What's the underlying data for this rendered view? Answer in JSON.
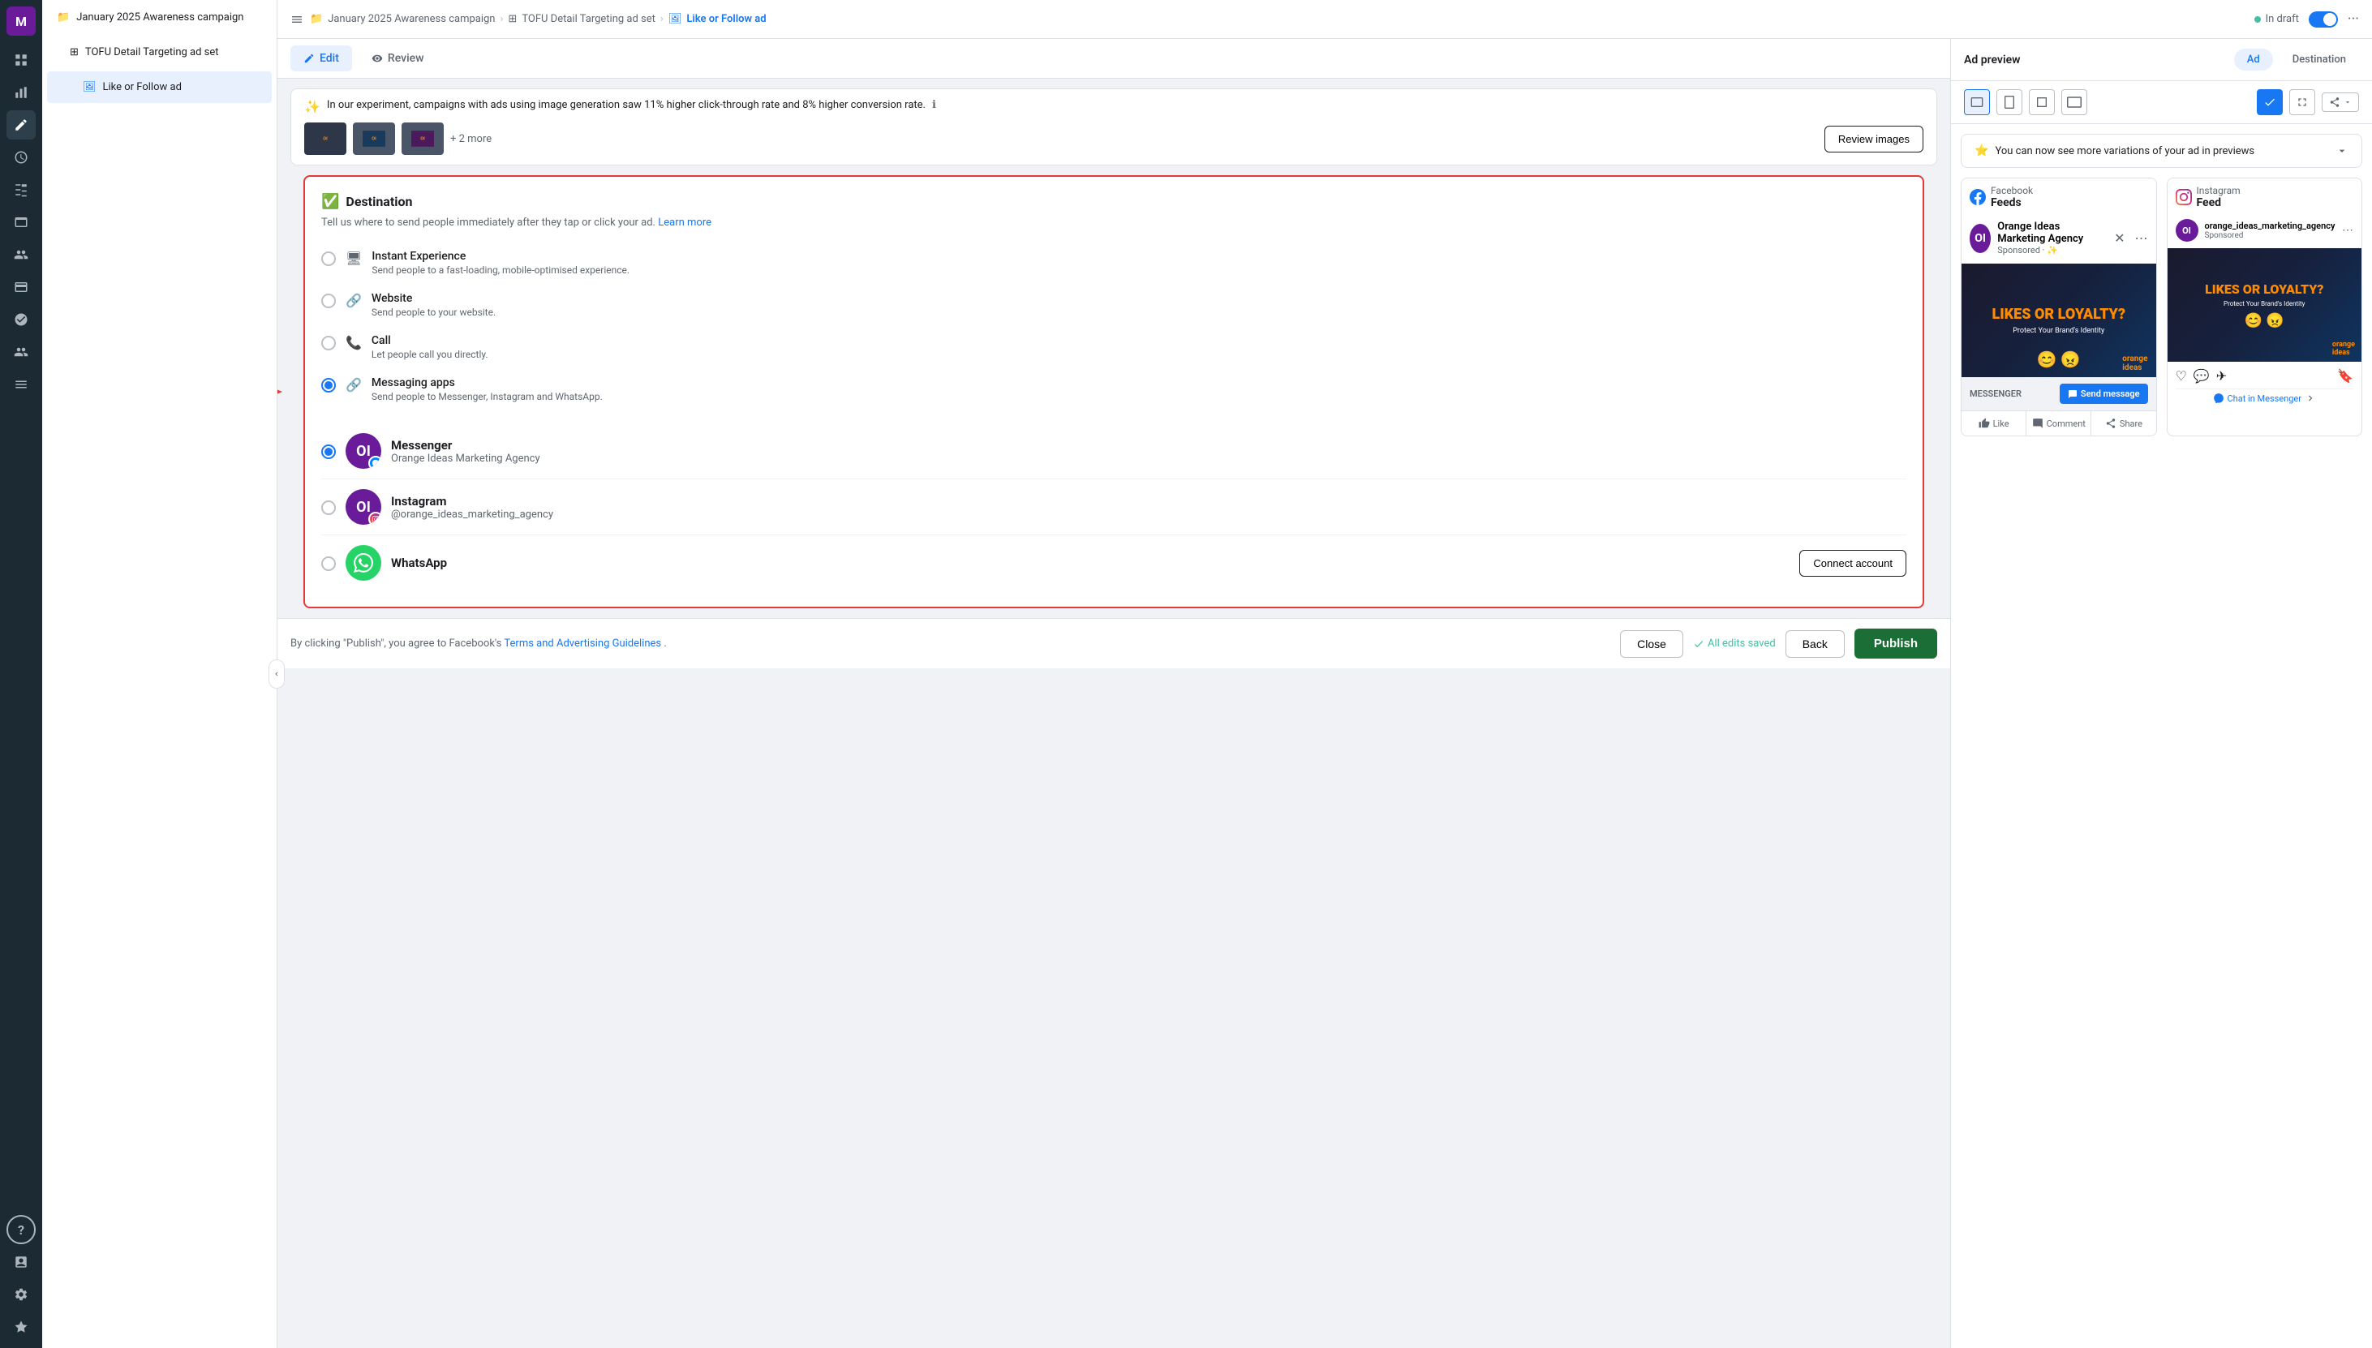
{
  "app": {
    "brand_initial": "M"
  },
  "sidebar_icons": [
    {
      "name": "brand-icon",
      "symbol": "M",
      "active": false
    },
    {
      "name": "bar-chart-icon",
      "symbol": "📊",
      "active": false
    },
    {
      "name": "pencil-icon",
      "symbol": "✏️",
      "active": true
    },
    {
      "name": "clock-icon",
      "symbol": "🕐",
      "active": false
    },
    {
      "name": "grid-icon",
      "symbol": "⊞",
      "active": false
    },
    {
      "name": "layers-icon",
      "symbol": "🗂",
      "active": false
    },
    {
      "name": "people-icon",
      "symbol": "👥",
      "active": false
    },
    {
      "name": "card-icon",
      "symbol": "💳",
      "active": false
    },
    {
      "name": "target-icon",
      "symbol": "🎯",
      "active": false
    },
    {
      "name": "org-icon",
      "symbol": "🔗",
      "active": false
    },
    {
      "name": "menu-icon",
      "symbol": "☰",
      "active": false
    }
  ],
  "nav": {
    "campaign_name": "January 2025 Awareness campaign",
    "adset_name": "TOFU Detail Targeting ad set",
    "ad_name": "Like or Follow ad"
  },
  "breadcrumb": {
    "campaign": "January 2025 Awareness campaign",
    "adset": "TOFU Detail Targeting ad set",
    "ad": "Like or Follow ad",
    "separator": ">"
  },
  "top_bar": {
    "sidebar_toggle": "📁",
    "status_label": "In draft",
    "more_icon": "···"
  },
  "edit_review": {
    "edit_label": "Edit",
    "review_label": "Review",
    "edit_icon": "✏️",
    "review_icon": "👁"
  },
  "ai_banner": {
    "text": "In our experiment, campaigns with ads using image generation saw 11% higher click-through rate and 8% higher conversion rate.",
    "info_icon": "ℹ"
  },
  "images": {
    "more_label": "+ 2 more",
    "review_button": "Review images"
  },
  "destination": {
    "title": "Destination",
    "description": "Tell us where to send people immediately after they tap or click your ad.",
    "learn_more": "Learn more",
    "options": [
      {
        "id": "instant-experience",
        "label": "Instant Experience",
        "description": "Send people to a fast-loading, mobile-optimised experience.",
        "icon": "🖥",
        "checked": false
      },
      {
        "id": "website",
        "label": "Website",
        "description": "Send people to your website.",
        "icon": "🔗",
        "checked": false
      },
      {
        "id": "call",
        "label": "Call",
        "description": "Let people call you directly.",
        "icon": "📞",
        "checked": false
      },
      {
        "id": "messaging-apps",
        "label": "Messaging apps",
        "description": "Send people to Messenger, Instagram and WhatsApp.",
        "icon": "🔗",
        "checked": true
      }
    ],
    "messaging_apps": [
      {
        "id": "messenger",
        "name": "Messenger",
        "handle": "Orange Ideas Marketing Agency",
        "avatar_text": "OI",
        "badge_color": "#0084ff",
        "checked": true
      },
      {
        "id": "instagram",
        "name": "Instagram",
        "handle": "@orange_ideas_marketing_agency",
        "avatar_text": "OI",
        "badge_type": "instagram",
        "checked": false
      },
      {
        "id": "whatsapp",
        "name": "WhatsApp",
        "handle": "",
        "checked": false,
        "connect_button": "Connect account"
      }
    ]
  },
  "footer": {
    "disclaimer": "By clicking \"Publish\", you agree to Facebook's",
    "terms_link": "Terms and Advertising Guidelines",
    "period": ".",
    "all_saved": "All edits saved",
    "close_btn": "Close",
    "back_btn": "Back",
    "publish_btn": "Publish"
  },
  "preview": {
    "ad_preview_label": "Ad preview",
    "tab_ad": "Ad",
    "tab_destination": "Destination",
    "platforms": [
      {
        "name": "Facebook",
        "feed": "Feeds"
      },
      {
        "name": "Instagram",
        "feed": "Feed"
      }
    ],
    "fb_card": {
      "account_name": "Orange Ideas Marketing Agency",
      "sponsored": "Sponsored · ✨",
      "image_text": "LIKES OR LOYALTY?",
      "image_subtext": "Protect Your Brand's Identity",
      "cta_label": "MESSENGER",
      "send_btn": "Send message",
      "action_like": "Like",
      "action_comment": "Comment",
      "action_share": "Share"
    },
    "ig_card": {
      "username": "orange_ideas_marketing_agency",
      "sponsored": "Sponsored",
      "image_text": "LIKES OR LOYALTY?",
      "image_subtext": "Protect Your Brand's Identity",
      "cta_label": "Chat in Messenger"
    }
  },
  "variations_banner": {
    "text": "You can now see more variations of your ad in previews"
  }
}
